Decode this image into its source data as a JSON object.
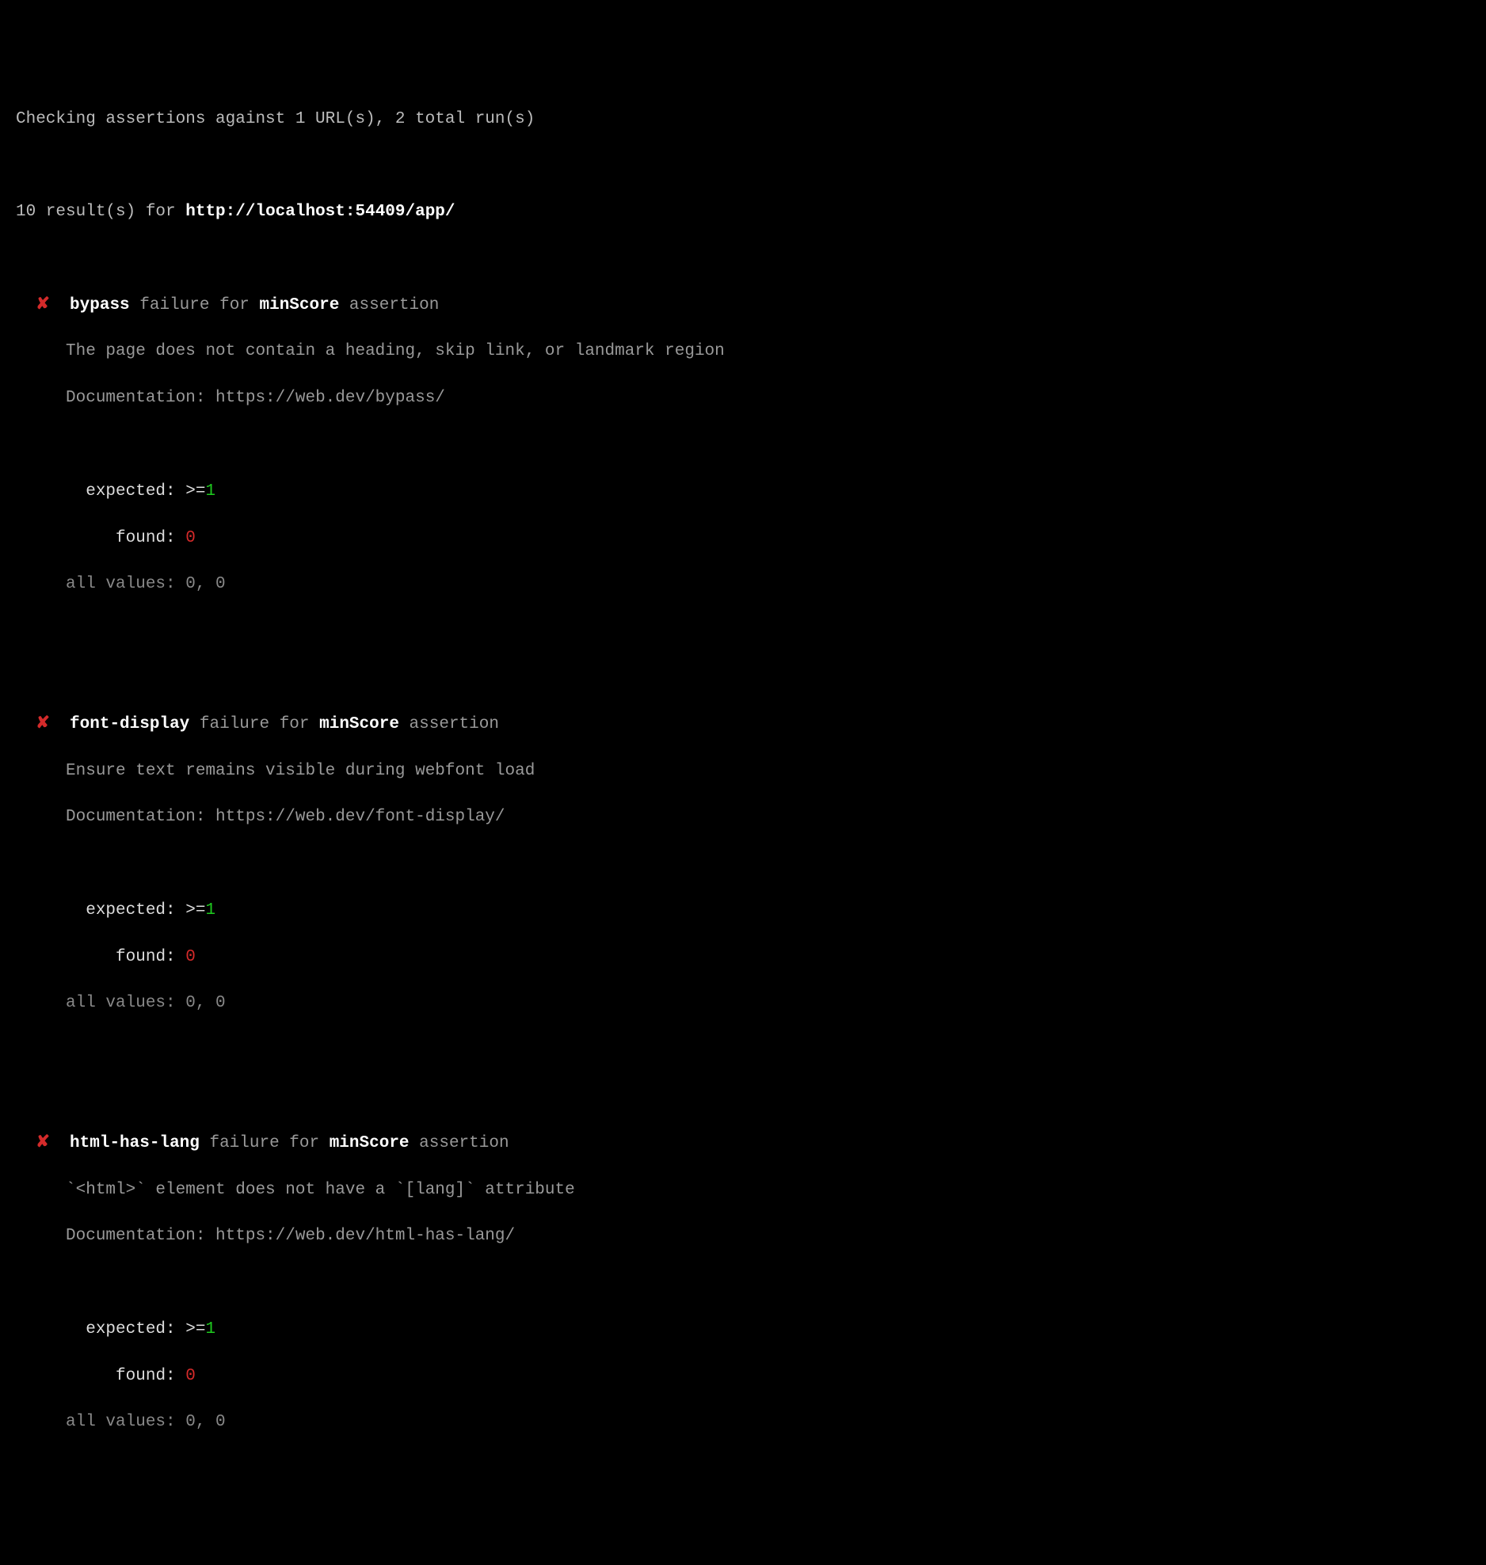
{
  "header": {
    "intro": "Checking assertions against 1 URL(s), 2 total run(s)",
    "results_count": "10 result(s) for ",
    "url": "http://localhost:54409/app/"
  },
  "mark": "✘",
  "labels": {
    "failure_for": " failure for ",
    "assertion_word": " assertion",
    "doc_prefix": "Documentation: ",
    "expected": "expected: ",
    "gte": ">=",
    "found": "found: ",
    "all_values": "all values: "
  },
  "failures": [
    {
      "name": "bypass",
      "check": "minScore",
      "desc": "The page does not contain a heading, skip link, or landmark region",
      "doc": "https://web.dev/bypass/",
      "expected": "1",
      "found": "0",
      "all_values": "0, 0"
    },
    {
      "name": "font-display",
      "check": "minScore",
      "desc": "Ensure text remains visible during webfont load",
      "doc": "https://web.dev/font-display/",
      "expected": "1",
      "found": "0",
      "all_values": "0, 0"
    },
    {
      "name": "html-has-lang",
      "check": "minScore",
      "desc": "`<html>` element does not have a `[lang]` attribute",
      "doc": "https://web.dev/html-has-lang/",
      "expected": "1",
      "found": "0",
      "all_values": "0, 0"
    }
  ]
}
